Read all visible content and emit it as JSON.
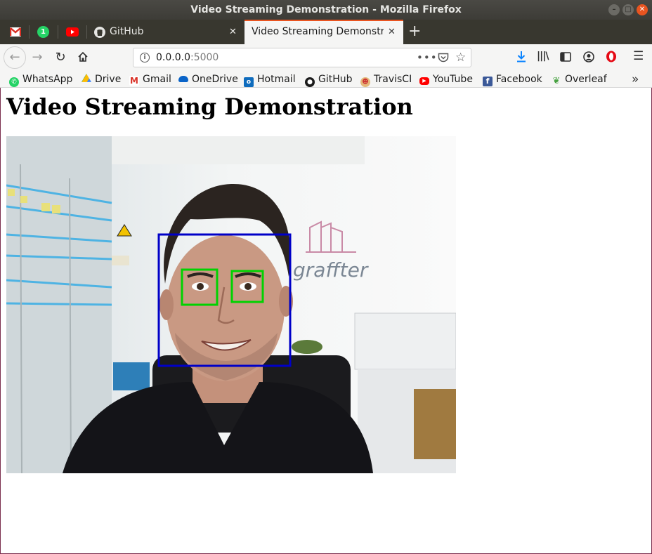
{
  "window": {
    "title": "Video Streaming Demonstration - Mozilla Firefox"
  },
  "tabs": [
    {
      "icon": "gmail-icon"
    },
    {
      "icon": "whatsapp-icon",
      "badge": "1"
    },
    {
      "icon": "youtube-icon"
    },
    {
      "label": "GitHub",
      "icon": "github-icon"
    },
    {
      "label": "Video Streaming Demonstra",
      "active": true
    }
  ],
  "toolbar": {
    "url_host": "0.0.0.0",
    "url_port": ":5000"
  },
  "bookmarks": [
    {
      "label": "WhatsApp",
      "icon": "whatsapp-icon"
    },
    {
      "label": "Drive",
      "icon": "drive-icon"
    },
    {
      "label": "Gmail",
      "icon": "gmail-icon"
    },
    {
      "label": "OneDrive",
      "icon": "onedrive-icon"
    },
    {
      "label": "Hotmail",
      "icon": "outlook-icon"
    },
    {
      "label": "GitHub",
      "icon": "github-icon"
    },
    {
      "label": "TravisCI",
      "icon": "travis-icon"
    },
    {
      "label": "YouTube",
      "icon": "youtube-icon"
    },
    {
      "label": "Facebook",
      "icon": "facebook-icon"
    },
    {
      "label": "Overleaf",
      "icon": "overleaf-icon"
    }
  ],
  "page": {
    "heading": "Video Streaming Demonstration",
    "video": {
      "wall_logo_text": "graffter",
      "face_box_color": "#0000c8",
      "eye_box_color": "#00d200"
    }
  },
  "colors": {
    "accent": "#e95420",
    "download": "#0a84ff",
    "opera": "#e50914"
  }
}
